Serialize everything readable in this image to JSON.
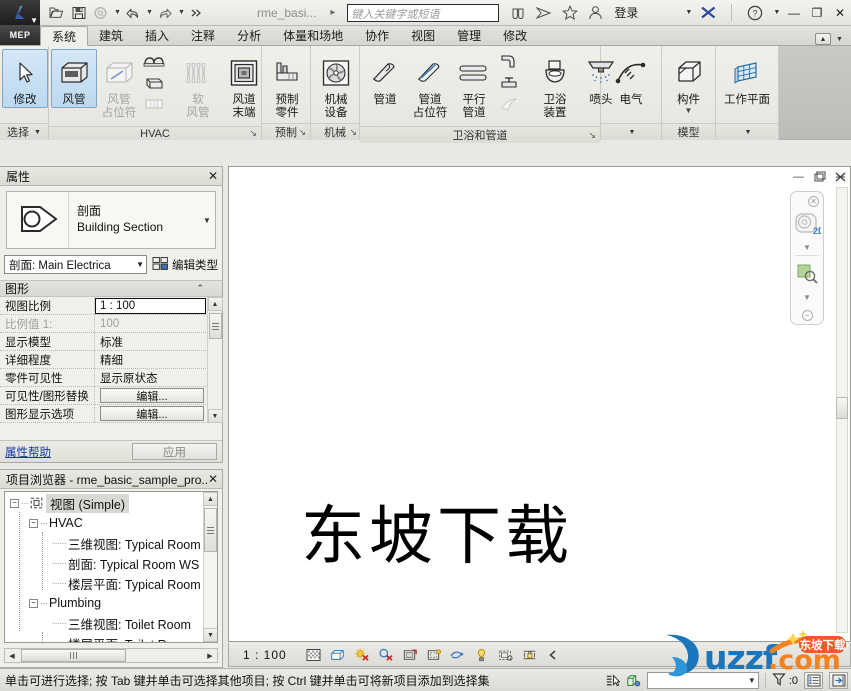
{
  "titlebar": {
    "app_icon": "revit-logo-icon",
    "quick_access": [
      {
        "name": "open-icon",
        "label": "打开"
      },
      {
        "name": "save-icon",
        "label": "保存"
      },
      {
        "name": "sync-icon",
        "label": "与中心文件同步"
      },
      {
        "name": "undo-icon",
        "label": "撤消"
      },
      {
        "name": "redo-icon",
        "label": "恢复"
      },
      {
        "name": "more-icon",
        "label": "更多"
      }
    ],
    "document_name": "rme_basi...",
    "search_placeholder": "键入关键字或短语",
    "right_icons": [
      {
        "name": "binoculars-icon"
      },
      {
        "name": "subscription-icon"
      },
      {
        "name": "star-icon"
      }
    ],
    "signin_label": "登录",
    "exchange_icon": "autodesk-exchange-icon",
    "help_icon": "help-icon",
    "window_buttons": {
      "minimize": "—",
      "maximize": "❐",
      "close": "✕"
    }
  },
  "tabs": {
    "product_badge": "MEP",
    "items": [
      {
        "label": "系统",
        "active": true
      },
      {
        "label": "建筑",
        "active": false
      },
      {
        "label": "插入",
        "active": false
      },
      {
        "label": "注释",
        "active": false
      },
      {
        "label": "分析",
        "active": false
      },
      {
        "label": "体量和场地",
        "active": false
      },
      {
        "label": "协作",
        "active": false
      },
      {
        "label": "视图",
        "active": false
      },
      {
        "label": "管理",
        "active": false
      },
      {
        "label": "修改",
        "active": false
      }
    ],
    "minimize_tooltip": "最小化功能区"
  },
  "ribbon": {
    "panels": [
      {
        "name": "选择",
        "footer": "选择",
        "has_dropdown": true,
        "buttons": [
          {
            "label": "修改",
            "icon": "cursor-arrow-icon",
            "selected": true,
            "disabled": false
          }
        ]
      },
      {
        "name": "HVAC",
        "footer": "HVAC",
        "has_dialog_launcher": true,
        "buttons": [
          {
            "label": "风管",
            "icon": "duct-icon",
            "selected": true,
            "disabled": false
          },
          {
            "label": "风管\n占位符",
            "icon": "duct-placeholder-icon",
            "selected": false,
            "disabled": true
          },
          {
            "label": "软\n风管",
            "icon": "flex-duct-icon",
            "selected": false,
            "disabled": true
          },
          {
            "label": "风道\n末端",
            "icon": "air-terminal-icon",
            "selected": false,
            "disabled": false
          }
        ],
        "small_buttons": [
          {
            "icon": "duct-fitting-icon",
            "disabled": false
          },
          {
            "icon": "duct-accessory-icon",
            "disabled": false
          },
          {
            "icon": "convert-to-duct-icon",
            "disabled": true
          }
        ]
      },
      {
        "name": "预制",
        "footer": "预制",
        "has_dialog_launcher": true,
        "buttons": [
          {
            "label": "预制\n零件",
            "icon": "fabrication-part-icon",
            "selected": false,
            "disabled": false
          }
        ]
      },
      {
        "name": "机械",
        "footer": "机械",
        "has_dialog_launcher": true,
        "buttons": [
          {
            "label": "机械\n设备",
            "icon": "mechanical-equipment-icon",
            "selected": false,
            "disabled": false
          }
        ]
      },
      {
        "name": "卫浴和管道",
        "footer": "卫浴和管道",
        "has_dialog_launcher": true,
        "buttons": [
          {
            "label": "管道",
            "icon": "pipe-icon",
            "selected": false,
            "disabled": false
          },
          {
            "label": "管道\n占位符",
            "icon": "pipe-placeholder-icon",
            "selected": false,
            "disabled": false
          },
          {
            "label": "平行\n管道",
            "icon": "parallel-pipes-icon",
            "selected": false,
            "disabled": false
          },
          {
            "label": "卫浴\n装置",
            "icon": "plumbing-fixture-icon",
            "selected": false,
            "disabled": false
          },
          {
            "label": "喷头",
            "icon": "sprinkler-icon",
            "selected": false,
            "disabled": false
          }
        ],
        "small_buttons": [
          {
            "icon": "pipe-fitting-icon",
            "disabled": false
          },
          {
            "icon": "pipe-accessory-icon",
            "disabled": false
          },
          {
            "icon": "flex-pipe-icon",
            "disabled": true
          }
        ]
      },
      {
        "name": "电气",
        "footer": "",
        "has_dropdown": true,
        "buttons": [
          {
            "label": "电气",
            "icon": "electrical-icon",
            "selected": false,
            "disabled": false
          }
        ]
      },
      {
        "name": "模型",
        "footer": "模型",
        "buttons": [
          {
            "label": "构件",
            "icon": "component-icon",
            "selected": false,
            "disabled": false,
            "split": true
          }
        ]
      },
      {
        "name": "工作平面",
        "footer": "",
        "has_dropdown": true,
        "buttons": [
          {
            "label": "工作平面",
            "icon": "work-plane-icon",
            "selected": false,
            "disabled": false
          }
        ]
      }
    ]
  },
  "properties": {
    "title": "属性",
    "close_icon": "close-icon",
    "type_preview_icon": "section-head-icon",
    "family": "剖面",
    "type": "Building Section",
    "instance_selector": "剖面: Main Electrica",
    "edit_type_label": "编辑类型",
    "edit_type_icon": "edit-type-icon",
    "group_header": "图形",
    "group_collapse_icon": "collapse-icon",
    "rows": [
      {
        "key": "视图比例",
        "value": "1 : 100",
        "type": "edit-active",
        "dim": false
      },
      {
        "key": "比例值 1:",
        "value": "100",
        "type": "text",
        "dim": true
      },
      {
        "key": "显示模型",
        "value": "标准",
        "type": "text",
        "dim": false
      },
      {
        "key": "详细程度",
        "value": "精细",
        "type": "text",
        "dim": false
      },
      {
        "key": "零件可见性",
        "value": "显示原状态",
        "type": "text",
        "dim": false
      },
      {
        "key": "可见性/图形替换",
        "value": "编辑...",
        "type": "button",
        "dim": false
      },
      {
        "key": "图形显示选项",
        "value": "编辑...",
        "type": "button",
        "dim": false
      }
    ],
    "help_link": "属性帮助",
    "apply_button": "应用"
  },
  "browser": {
    "title": "项目浏览器 - rme_basic_sample_pro...",
    "close_icon": "close-icon",
    "tree": [
      {
        "depth": 0,
        "label": "视图 (Simple)",
        "expander": "-",
        "icon": "view-group-icon",
        "selected": true
      },
      {
        "depth": 1,
        "label": "HVAC",
        "expander": "-",
        "icon": "",
        "selected": false
      },
      {
        "depth": 2,
        "label": "三维视图: Typical Room",
        "expander": "",
        "icon": "",
        "selected": false
      },
      {
        "depth": 2,
        "label": "剖面: Typical Room WS",
        "expander": "",
        "icon": "",
        "selected": false
      },
      {
        "depth": 2,
        "label": "楼层平面: Typical Room",
        "expander": "",
        "icon": "",
        "selected": false
      },
      {
        "depth": 1,
        "label": "Plumbing",
        "expander": "-",
        "icon": "",
        "selected": false
      },
      {
        "depth": 2,
        "label": "三维视图: Toilet Room",
        "expander": "",
        "icon": "",
        "selected": false
      },
      {
        "depth": 2,
        "label": "楼层平面: Toilet Room",
        "expander": "",
        "icon": "",
        "selected": false
      }
    ]
  },
  "canvas": {
    "watermark_text": "东坡下载",
    "window_buttons": {
      "minimize": "—",
      "restore": "❐",
      "close": "✕"
    },
    "navbar": {
      "close_icon": "close-small-icon",
      "steering_wheel_icon": "steering-wheel-2d-icon",
      "zoom_icon": "zoom-region-icon",
      "options_icon": "nav-options-icon"
    },
    "logo": {
      "text": "uzzf.com",
      "badge": "东坡下载",
      "primary_color": "#1b75bb",
      "accent_color": "#f58220"
    }
  },
  "view_control_bar": {
    "scale": "1 : 100",
    "icons": [
      {
        "name": "detail-level-icon"
      },
      {
        "name": "visual-style-icon"
      },
      {
        "name": "sun-path-off-icon"
      },
      {
        "name": "shadows-off-icon"
      },
      {
        "name": "render-dialog-icon"
      },
      {
        "name": "crop-view-icon"
      },
      {
        "name": "show-crop-region-icon"
      },
      {
        "name": "temporary-hide-isolate-icon"
      },
      {
        "name": "reveal-hidden-elements-icon"
      },
      {
        "name": "temporary-view-properties-icon"
      },
      {
        "name": "analytical-model-icon"
      },
      {
        "name": "constraints-icon"
      }
    ],
    "collapse_icon": "collapse-left-icon"
  },
  "status_bar": {
    "hint": "单击可进行选择; 按 Tab 键并单击可选择其他项目; 按 Ctrl 键并单击可将新项目添加到选择集",
    "press_pick_icon": "press-pick-icon",
    "model_icon": "worksets-icon",
    "filter_count": ":0",
    "filter_icon": "filter-icon",
    "list_icon": "list-icon",
    "expand_icon": "expand-icon",
    "combo_value": ""
  },
  "colors": {
    "ribbon_bg": "#f0efe9",
    "selected_blue": "#bcd9f0",
    "selected_border": "#7ea6c8",
    "panel_border": "#a9a9a4",
    "canvas_bg": "#ffffff",
    "link_blue": "#1339a8",
    "logo_blue": "#1b75bb",
    "logo_orange": "#f58220"
  }
}
